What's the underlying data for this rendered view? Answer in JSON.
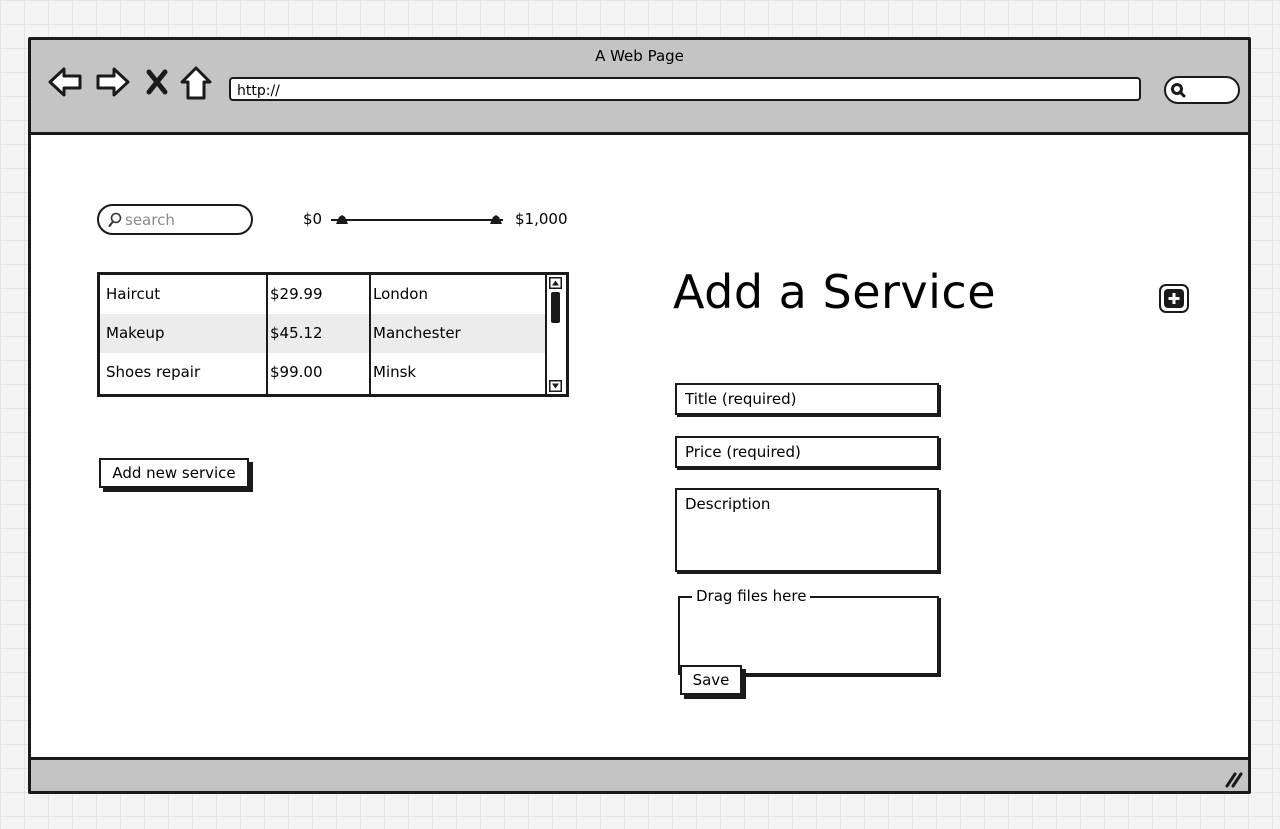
{
  "window": {
    "title": "A Web Page"
  },
  "browser": {
    "url": "http://",
    "nav_icons": [
      "back-arrow-icon",
      "forward-arrow-icon",
      "stop-icon",
      "home-icon"
    ],
    "search_icon": "magnifier-icon"
  },
  "filters": {
    "search_placeholder": "search",
    "price_min_label": "$0",
    "price_max_label": "$1,000",
    "price_min_fraction": 0.0,
    "price_max_fraction": 1.0
  },
  "services": {
    "rows": [
      {
        "name": "Haircut",
        "price": "$29.99",
        "city": "London"
      },
      {
        "name": "Makeup",
        "price": "$45.12",
        "city": "Manchester"
      },
      {
        "name": "Shoes repair",
        "price": "$99.00",
        "city": "Minsk"
      }
    ],
    "add_button_label": "Add new service"
  },
  "form": {
    "title": "Add a Service",
    "title_placeholder": "Title (required)",
    "price_placeholder": "Price (required)",
    "description_placeholder": "Description",
    "dropzone_label": "Drag files here",
    "save_label": "Save"
  },
  "colors": {
    "chrome": "#c4c4c4",
    "ink": "#1a1a1a",
    "row_alt": "#ececec"
  }
}
